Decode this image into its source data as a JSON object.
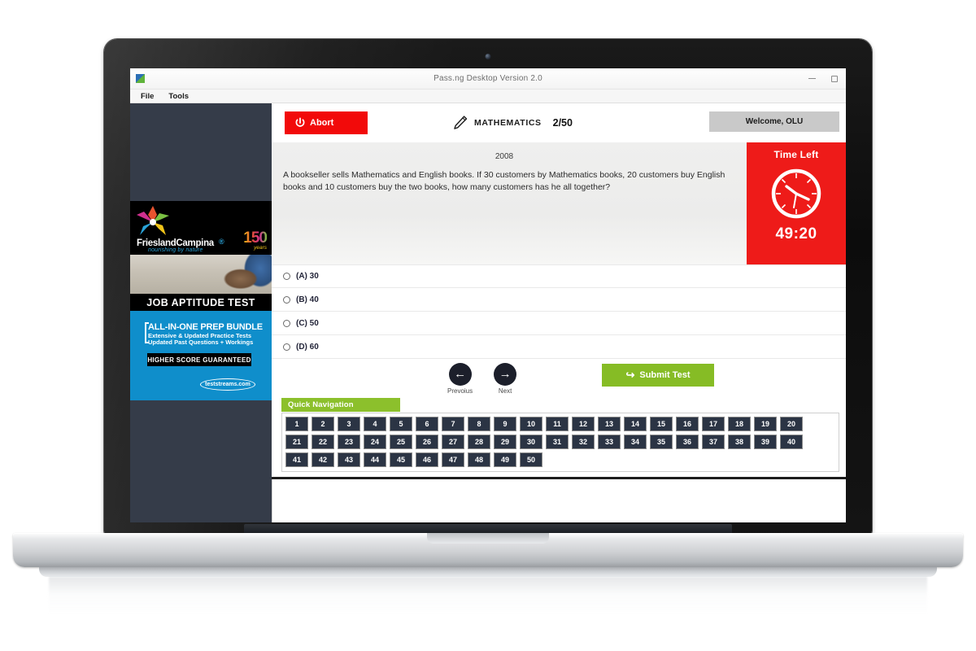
{
  "window": {
    "title": "Pass.ng   Desktop Version 2.0",
    "app_icon": "app-logo-icon",
    "minimize_label": "–",
    "maximize_label": "□",
    "close_label": "×",
    "menus": [
      "File",
      "Tools"
    ]
  },
  "exam": {
    "abort_label": "Abort",
    "abort_color": "#f20a0a",
    "subject": "MATHEMATICS",
    "question_counter": "2/50",
    "welcome": "Welcome, OLU",
    "year": "2008",
    "question_text": "A bookseller sells Mathematics and English books. If 30 customers by Mathematics books, 20 customers buy English books and 10 customers buy the two books, how many customers has he all together?",
    "options": [
      {
        "letter": "(A)",
        "value": "30",
        "label": "(A) 30",
        "selected": false
      },
      {
        "letter": "(B)",
        "value": "40",
        "label": "(B) 40",
        "selected": false
      },
      {
        "letter": "(C)",
        "value": "50",
        "label": "(C) 50",
        "selected": false
      },
      {
        "letter": "(D)",
        "value": "60",
        "label": "(D) 60",
        "selected": false
      }
    ],
    "timer": {
      "title": "Time Left",
      "value": "49:20",
      "background": "#ee1b19"
    },
    "navigation": {
      "previous_label": "Prevoius",
      "next_label": "Next",
      "previous_arrow": "←",
      "next_arrow": "→"
    },
    "submit": {
      "label": "Submit Test",
      "arrow": "↪",
      "color": "#86bc25"
    },
    "quick_navigation": {
      "title": "Quick Navigation",
      "title_color": "#8cc02c",
      "button_color": "#2b3444",
      "rows": [
        [
          "1",
          "2",
          "3",
          "4",
          "5",
          "6",
          "7",
          "8",
          "9",
          "10",
          "11",
          "12",
          "13",
          "14",
          "15",
          "16",
          "17",
          "18",
          "19",
          "20"
        ],
        [
          "21",
          "22",
          "23",
          "24",
          "25",
          "26",
          "27",
          "28",
          "29",
          "30",
          "31",
          "32",
          "33",
          "34",
          "35",
          "36",
          "37",
          "38",
          "39",
          "40"
        ],
        [
          "41",
          "42",
          "43",
          "44",
          "45",
          "46",
          "47",
          "48",
          "49",
          "50"
        ]
      ]
    }
  },
  "ads": {
    "friesland": {
      "brand": "FrieslandCampina",
      "registered": "®",
      "tagline": "nourishing by nature",
      "anniversary_number": "150",
      "anniversary_word": "years",
      "title": "JOB APTITUDE TEST"
    },
    "prep": {
      "headline": "ALL-IN-ONE PREP BUNDLE",
      "line1": "Extensive & Updated Practice Tests",
      "line2": "Updated Past Questions + Workings",
      "guarantee": "HIGHER SCORE GUARANTEED",
      "brand": "teststreams.com",
      "background": "#0f8ecb"
    }
  }
}
